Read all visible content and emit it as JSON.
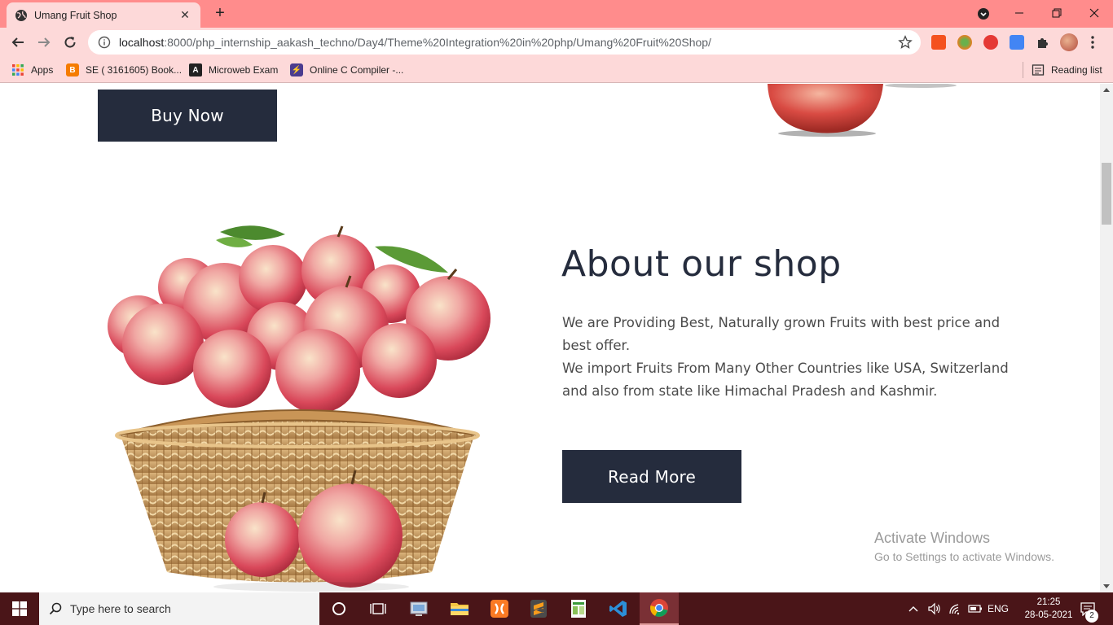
{
  "browser": {
    "tab_title": "Umang Fruit Shop",
    "url_host": "localhost",
    "url_rest": ":8000/php_internship_aakash_techno/Day4/Theme%20Integration%20in%20php/Umang%20Fruit%20Shop/",
    "bookmarks": [
      {
        "label": "Apps",
        "icon": "apps-grid-icon"
      },
      {
        "label": "SE ( 3161605) Book...",
        "icon": "blogger-icon"
      },
      {
        "label": "Microweb Exam",
        "icon": "angular-icon"
      },
      {
        "label": "Online C Compiler -...",
        "icon": "replit-bolt-icon"
      }
    ],
    "reading_list": "Reading list",
    "colors": {
      "frame": "#ff8c8c",
      "toolbar": "#fdd9d9"
    }
  },
  "page": {
    "buy_now": "Buy Now",
    "about_title": "About our shop",
    "about_line1": "We are Providing Best, Naturally grown Fruits with best price and best offer.",
    "about_line2": "We import Fruits From Many Other Countries like USA, Switzerland and also from state like Himachal Pradesh and Kashmir.",
    "read_more": "Read More",
    "button_color": "#252c3d",
    "title_color": "#252c3d"
  },
  "watermark": {
    "line1": "Activate Windows",
    "line2": "Go to Settings to activate Windows."
  },
  "taskbar": {
    "search_placeholder": "Type here to search",
    "language": "ENG",
    "time": "21:25",
    "date": "28-05-2021",
    "notification_count": "2",
    "color": "#4a1518"
  }
}
